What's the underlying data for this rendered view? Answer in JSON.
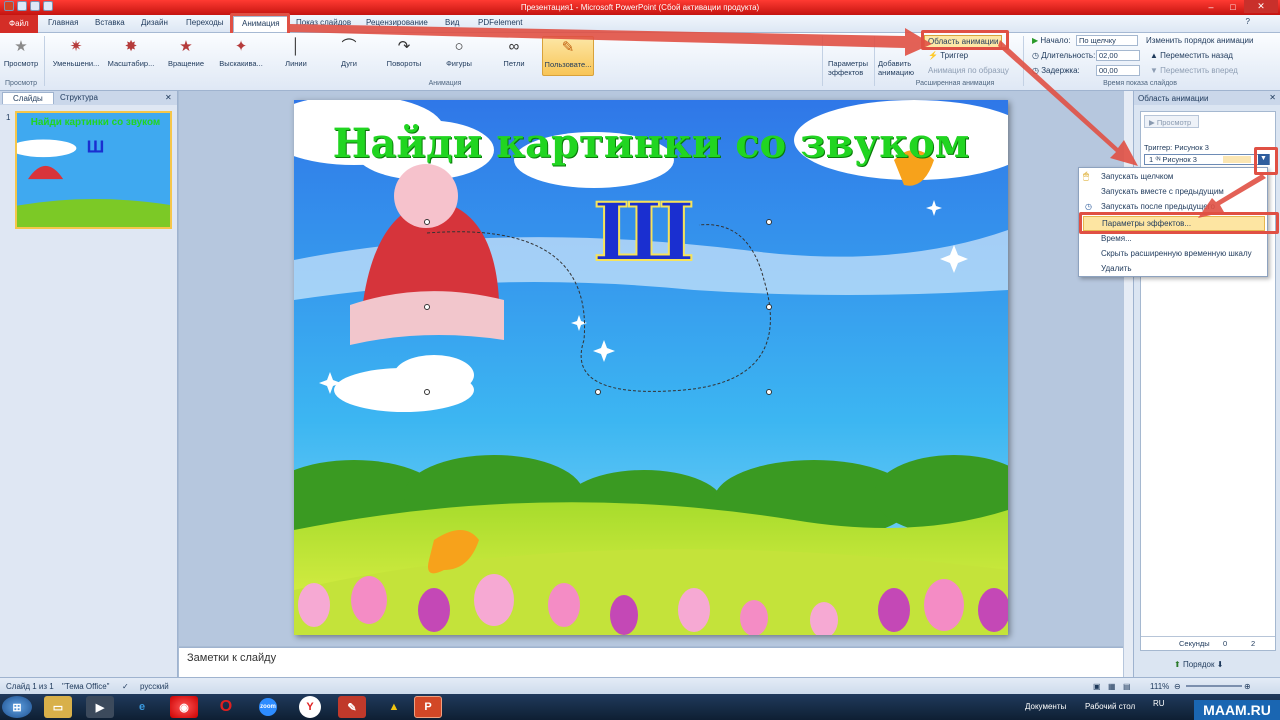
{
  "window": {
    "title": "Презентация1 - Microsoft PowerPoint (Сбой активации продукта)"
  },
  "tabs": {
    "file": "Файл",
    "items": [
      "Главная",
      "Вставка",
      "Дизайн",
      "Переходы",
      "Анимация",
      "Показ слайдов",
      "Рецензирование",
      "Вид",
      "PDFelement"
    ],
    "active": "Анимация"
  },
  "ribbon": {
    "preview": {
      "label": "Просмотр",
      "group": "Просмотр"
    },
    "animations": [
      "Уменьшени...",
      "Масштабир...",
      "Вращение",
      "Выскакива...",
      "Линии",
      "Дуги",
      "Повороты",
      "Фигуры",
      "Петли",
      "Пользовате..."
    ],
    "effect_params": "Параметры эффектов",
    "group_animation": "Анимация",
    "add_animation": "Добавить анимацию",
    "anim_pane": "Область анимации",
    "trigger": "Триггер",
    "painter": "Анимация по образцу",
    "group_advanced": "Расширенная анимация",
    "start_label": "Начало:",
    "start_value": "По щелчку",
    "duration_label": "Длительность:",
    "duration_value": "02,00",
    "delay_label": "Задержка:",
    "delay_value": "00,00",
    "reorder": "Изменить порядок анимации",
    "move_back": "Переместить назад",
    "move_forward": "Переместить вперед",
    "group_timing": "Время показа слайдов"
  },
  "left_panel": {
    "tab_slides": "Слайды",
    "tab_outline": "Структура",
    "slide_number": "1"
  },
  "slide": {
    "title": "Найди картинки со звуком",
    "letter": "Ш"
  },
  "notes": {
    "placeholder": "Заметки к слайду"
  },
  "anim_pane": {
    "title": "Область анимации",
    "play": "Просмотр",
    "trigger_label": "Триггер: Рисунок 3",
    "item": "1 ⁽ᴺ Рисунок 3",
    "seconds": "Секунды",
    "tick0": "0",
    "tick2": "2",
    "order": "Порядок"
  },
  "context_menu": [
    "Запускать щелчком",
    "Запускать вместе с предыдущим",
    "Запускать после предыдущего",
    "Параметры эффектов...",
    "Время...",
    "Скрыть расширенную временную шкалу",
    "Удалить"
  ],
  "status": {
    "slide": "Слайд 1 из 1",
    "theme": "\"Тема Office\"",
    "lang": "русский",
    "zoom": "111%"
  },
  "taskbar": {
    "documents": "Документы",
    "desktop": "Рабочий стол",
    "lang": "RU",
    "brand": "MAAM.RU",
    "zoom_app": "zoom"
  },
  "colors": {
    "accent_red": "#e05044",
    "title_green": "#21d521",
    "letter_blue": "#1a2fd0"
  }
}
